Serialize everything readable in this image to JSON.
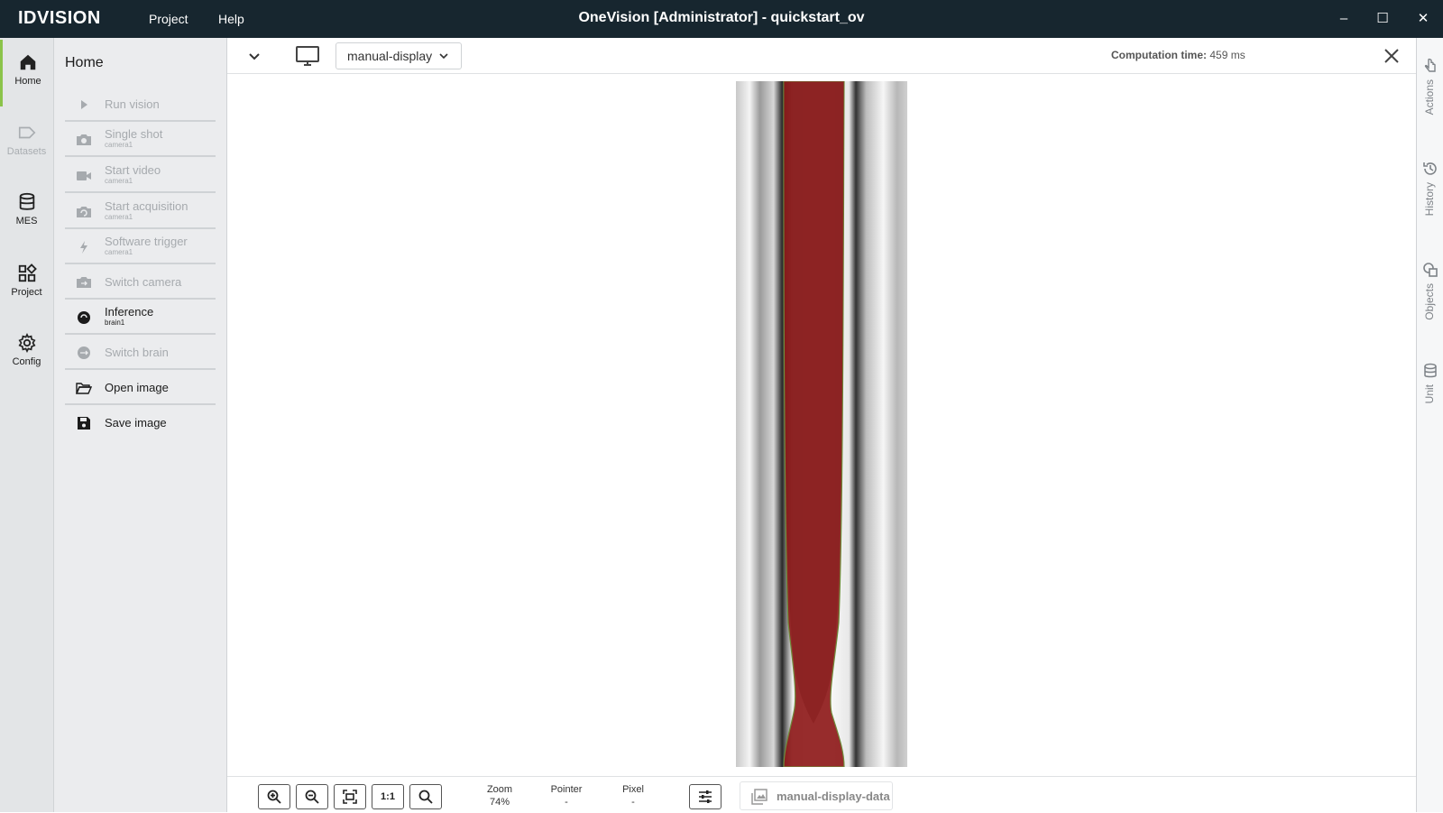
{
  "app": {
    "logo": "IDVISION",
    "menu": [
      "Project",
      "Help"
    ],
    "window_title": "OneVision [Administrator]  -  quickstart_ov",
    "controls": {
      "minimize": "–",
      "maximize": "☐",
      "close": "✕"
    }
  },
  "rail": [
    {
      "label": "Home",
      "icon": "home-icon"
    },
    {
      "label": "Datasets",
      "icon": "tag-icon"
    },
    {
      "label": "MES",
      "icon": "database-icon"
    },
    {
      "label": "Project",
      "icon": "grid-icon"
    },
    {
      "label": "Config",
      "icon": "gear-icon"
    }
  ],
  "panel": {
    "title": "Home",
    "items": [
      {
        "label": "Run vision",
        "sub": "",
        "icon": "play-icon"
      },
      {
        "label": "Single shot",
        "sub": "camera1",
        "icon": "camera-icon"
      },
      {
        "label": "Start video",
        "sub": "camera1",
        "icon": "video-icon"
      },
      {
        "label": "Start acquisition",
        "sub": "camera1",
        "icon": "acquisition-icon"
      },
      {
        "label": "Software trigger",
        "sub": "camera1",
        "icon": "lightning-icon"
      },
      {
        "label": "Switch camera",
        "sub": "",
        "icon": "switch-camera-icon"
      },
      {
        "label": "Inference",
        "sub": "brain1",
        "icon": "brain-icon"
      },
      {
        "label": "Switch brain",
        "sub": "",
        "icon": "switch-brain-icon"
      },
      {
        "label": "Open image",
        "sub": "",
        "icon": "folder-open-icon"
      },
      {
        "label": "Save image",
        "sub": "",
        "icon": "save-icon"
      }
    ]
  },
  "toolbar": {
    "display_select": "manual-display",
    "computation_label": "Computation time:",
    "computation_value": "459 ms"
  },
  "bottom": {
    "one_to_one": "1:1",
    "zoom_label": "Zoom",
    "zoom_value": "74%",
    "pointer_label": "Pointer",
    "pointer_value": "-",
    "pixel_label": "Pixel",
    "pixel_value": "-",
    "data_label": "manual-display-data"
  },
  "right": [
    {
      "label": "Actions",
      "icon": "actions-icon"
    },
    {
      "label": "History",
      "icon": "history-icon"
    },
    {
      "label": "Objects",
      "icon": "objects-icon"
    },
    {
      "label": "Unit",
      "icon": "unit-icon"
    }
  ],
  "colors": {
    "titlebar": "#17262f",
    "accent": "#8bc34a",
    "segmentation": "#8e1a1a"
  }
}
